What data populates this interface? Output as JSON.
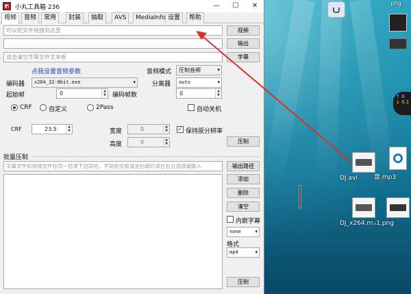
{
  "window": {
    "title": "小丸工具箱 236",
    "minimize": "—",
    "maximize": "☐",
    "close": "✕"
  },
  "tabs": [
    "视频",
    "音频",
    "常用",
    "封装",
    "抽取",
    "AVS",
    "MediaInfo",
    "设置",
    "帮助"
  ],
  "video": {
    "file_placeholder": "可以把文件拖拽到这里",
    "video_button": "视频",
    "output_button": "输出",
    "subtitle_placeholder": "双击清空字幕文件文本框",
    "subtitle_button": "字幕",
    "audio_params_link": "点我设置音频参数",
    "audio_mode_label": "音频模式",
    "audio_mode_value": "压制音频",
    "encoder_label": "编码器",
    "encoder_value": "x264_32-8bit.exe",
    "demuxer_label": "分离器",
    "demuxer_value": "auto",
    "start_frame_label": "起始帧",
    "start_frame_value": "0",
    "encode_frames_label": "编码帧数",
    "encode_frames_value": "0",
    "mode_crf": "CRF",
    "mode_custom": "自定义",
    "mode_2pass": "2Pass",
    "auto_shutdown": "自动关机",
    "crf_label": "CRF",
    "crf_value": "23.5",
    "width_label": "宽度",
    "width_value": "0",
    "height_label": "高度",
    "height_value": "0",
    "keep_resolution": "保持原分辨率",
    "encode_button": "压制"
  },
  "batch": {
    "section_label": "批量压制",
    "hint": "字幕文件和视频文件在同一目录下且同名，不同名仅有语言后缀时请在右方选择或输入",
    "output_path_button": "输出路径",
    "add_button": "添加",
    "delete_button": "删除",
    "clear_button": "清空",
    "embed_subtitle": "内嵌字幕",
    "embed_value": "none",
    "format_label": "格式",
    "format_value": "mp4",
    "encode_button": "压制"
  },
  "desktop": {
    "top_label": ".png",
    "file1": "DJ.avi",
    "file2": "音.mp3",
    "file3": "DJ_x264.m...",
    "file4": "-1.png",
    "widget_up": "↑ 0",
    "widget_down": "↓ 0.1"
  },
  "colors": {
    "accent_blue": "#1f4aa5",
    "arrow_red": "#d9302a",
    "title_icon": "#a71f2a"
  }
}
